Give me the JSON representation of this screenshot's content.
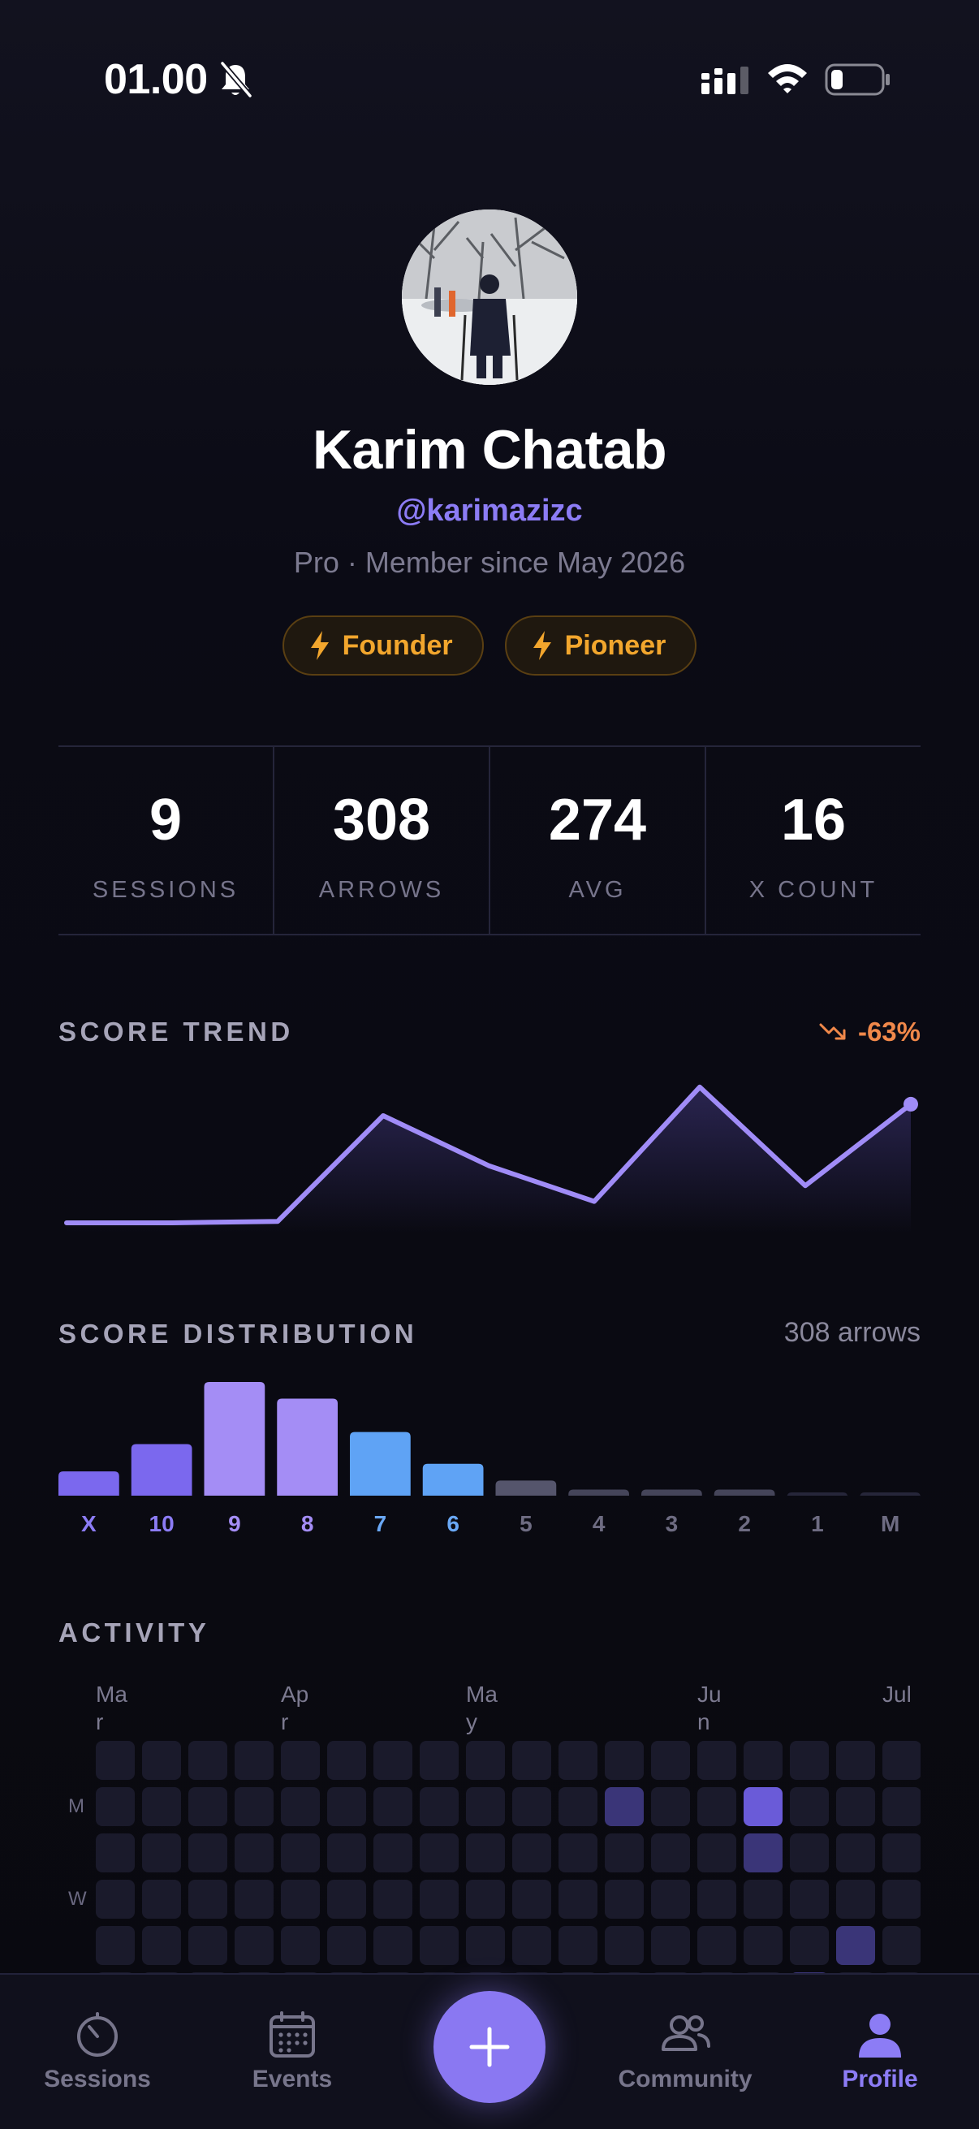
{
  "status_bar": {
    "time": "01.00"
  },
  "profile": {
    "name": "Karim Chatab",
    "handle": "@karimazizc",
    "membership": "Pro · Member since May 2026",
    "badges": [
      {
        "label": "Founder",
        "icon": "bolt-icon"
      },
      {
        "label": "Pioneer",
        "icon": "bolt-icon"
      }
    ]
  },
  "stats": [
    {
      "value": "9",
      "label": "SESSIONS"
    },
    {
      "value": "308",
      "label": "ARROWS"
    },
    {
      "value": "274",
      "label": "AVG"
    },
    {
      "value": "16",
      "label": "X COUNT"
    }
  ],
  "score_trend": {
    "title": "SCORE TREND",
    "delta": "-63%",
    "colors": {
      "line": "#a08cf7",
      "delta": "#f0884a"
    }
  },
  "score_distribution": {
    "title": "SCORE DISTRIBUTION",
    "count_label": "308 arrows"
  },
  "chart_data": [
    {
      "type": "line",
      "title": "SCORE TREND",
      "x": [
        1,
        2,
        3,
        4,
        5,
        6,
        7,
        8,
        9
      ],
      "y": [
        0,
        0,
        1,
        75,
        40,
        15,
        95,
        26,
        83
      ],
      "ylim": [
        0,
        100
      ],
      "grid": false
    },
    {
      "type": "bar",
      "title": "SCORE DISTRIBUTION",
      "categories": [
        "X",
        "10",
        "9",
        "8",
        "7",
        "6",
        "5",
        "4",
        "3",
        "2",
        "1",
        "M"
      ],
      "values": [
        16,
        34,
        75,
        64,
        42,
        21,
        10,
        4,
        4,
        4,
        2,
        2
      ],
      "ylim": [
        0,
        75
      ],
      "bar_colors": [
        "#7b68ee",
        "#7b68ee",
        "#a48df5",
        "#a48df5",
        "#5fa3f5",
        "#5fa3f5",
        "#55556c",
        "#45455a",
        "#45455a",
        "#45455a",
        "#26263a",
        "#26263a"
      ],
      "label_colors": [
        "#8c7cf5",
        "#8c7cf5",
        "#a48df5",
        "#a48df5",
        "#6aa8f5",
        "#6aa8f5",
        "#6e6c82",
        "#6e6c82",
        "#6e6c82",
        "#6e6c82",
        "#6e6c82",
        "#6e6c82"
      ]
    }
  ],
  "activity": {
    "title": "ACTIVITY",
    "months": [
      {
        "label": "Ma r",
        "col": 0
      },
      {
        "label": "Ap r",
        "col": 4
      },
      {
        "label": "Ma y",
        "col": 8
      },
      {
        "label": "Ju n",
        "col": 13
      },
      {
        "label": "Jul",
        "col": 17
      }
    ],
    "day_labels": [
      {
        "label": "M",
        "row": 1
      },
      {
        "label": "W",
        "row": 3
      }
    ],
    "rows": [
      [
        0,
        0,
        0,
        0,
        0,
        0,
        0,
        0,
        0,
        0,
        0,
        0,
        0,
        0,
        0,
        0,
        0,
        0
      ],
      [
        0,
        0,
        0,
        0,
        0,
        0,
        0,
        0,
        0,
        0,
        0,
        1,
        0,
        0,
        2,
        0,
        0,
        0
      ],
      [
        0,
        0,
        0,
        0,
        0,
        0,
        0,
        0,
        0,
        0,
        0,
        0,
        0,
        0,
        1,
        0,
        0,
        0
      ],
      [
        0,
        0,
        0,
        0,
        0,
        0,
        0,
        0,
        0,
        0,
        0,
        0,
        0,
        0,
        0,
        0,
        0,
        0
      ],
      [
        0,
        0,
        0,
        0,
        0,
        0,
        0,
        0,
        0,
        0,
        0,
        0,
        0,
        0,
        0,
        0,
        1,
        0
      ],
      [
        0,
        0,
        0,
        0,
        0,
        0,
        0,
        0,
        0,
        0,
        0,
        0,
        0,
        0,
        0,
        1,
        0,
        0
      ]
    ]
  },
  "nav": {
    "tabs": [
      {
        "label": "Sessions",
        "icon": "stopwatch-icon",
        "active": false
      },
      {
        "label": "Events",
        "icon": "calendar-icon",
        "active": false
      },
      {
        "label": "Community",
        "icon": "people-icon",
        "active": false
      },
      {
        "label": "Profile",
        "icon": "person-icon",
        "active": true
      }
    ],
    "fab_icon": "plus-icon",
    "accent": "#8a78f2"
  }
}
